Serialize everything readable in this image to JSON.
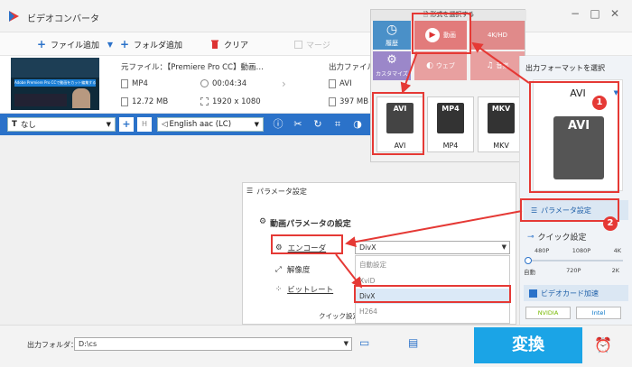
{
  "app": {
    "title": "ビデオコンバータ"
  },
  "toolbar": {
    "add_file": "ファイル追加",
    "add_folder": "フォルダ追加",
    "clear": "クリア",
    "merge": "マージ"
  },
  "file": {
    "source_label": "元ファイル：",
    "source_name": "【Premiere Pro CC】動画…",
    "format": "MP4",
    "duration": "00:04:34",
    "size": "12.72 MB",
    "resolution": "1920 x 1080",
    "output_label": "出力ファイル",
    "output_format": "AVI",
    "output_size": "397 MB",
    "thumb_caption": "Adobe Premiere Pro CCで動画をカット編集する方法"
  },
  "editbar": {
    "subtitle": "なし",
    "audio": "English aac (LC)"
  },
  "format_popup": {
    "header": "形式を選択する",
    "tab_history": "履歴",
    "tab_video": "動画",
    "tab_4k": "4K/HD",
    "tab_custom": "カスタマイズ",
    "tab_web": "ウェブ",
    "tab_audio": "音楽",
    "formats": [
      {
        "name": "AVI",
        "badge": "AVI"
      },
      {
        "name": "MP4",
        "badge": "MP4"
      },
      {
        "name": "MKV",
        "badge": "MKV"
      }
    ]
  },
  "right_panel": {
    "title": "出力フォーマットを選択",
    "selected_format": "AVI",
    "param_button": "パラメータ設定",
    "quick_setting": "クイック設定",
    "res_top": [
      "480P",
      "1080P",
      "4K"
    ],
    "res_bottom": [
      "自動",
      "720P",
      "2K"
    ],
    "gpu_label": "ビデオカード加速",
    "nvidia": "NVIDIA",
    "intel": "Intel"
  },
  "param_dialog": {
    "title": "パラメータ設定",
    "section": "動画パラメータの設定",
    "encoder_label": "エンコーダ",
    "encoder_value": "DivX",
    "resolution_label": "解像度",
    "bitrate_label": "ビットレート",
    "quick_label": "クイック設定",
    "encoder_options": [
      "自動設定",
      "XviD",
      "DivX",
      "H264"
    ]
  },
  "bottom": {
    "output_folder_label": "出力フォルダ：",
    "output_folder_value": "D:\\cs",
    "convert": "変換"
  },
  "annotations": {
    "badge1": "1",
    "badge2": "2"
  },
  "colors": {
    "accent": "#2b72c9",
    "convert_bg": "#1ba4e6",
    "highlight": "#e53935"
  }
}
